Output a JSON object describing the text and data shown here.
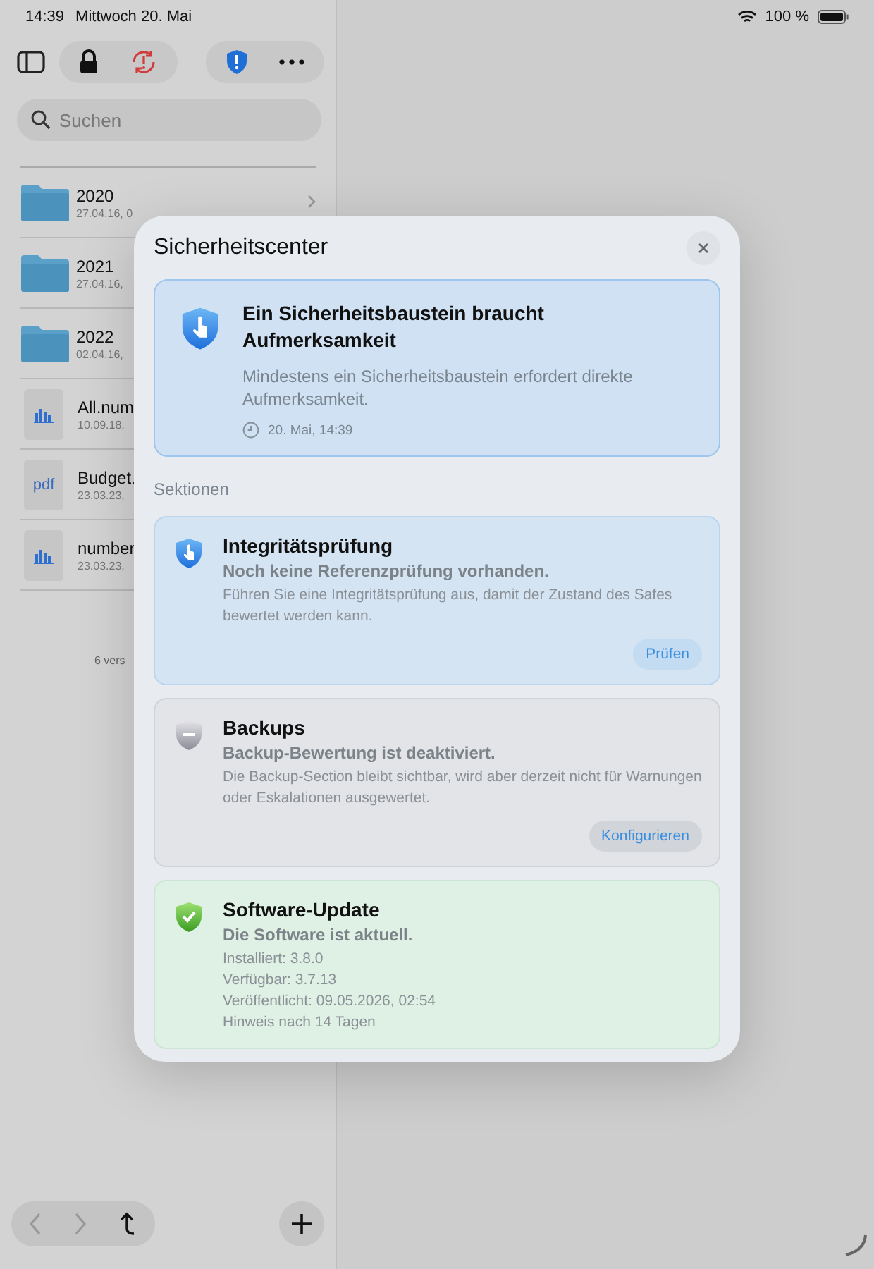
{
  "status_bar": {
    "time": "14:39",
    "date": "Mittwoch 20. Mai",
    "battery": "100 %"
  },
  "sidebar": {
    "search": {
      "placeholder": "Suchen"
    },
    "items": [
      {
        "kind": "folder",
        "name": "2020",
        "meta": "27.04.16, 0",
        "chevron": true
      },
      {
        "kind": "folder",
        "name": "2021",
        "meta": "27.04.16,"
      },
      {
        "kind": "folder",
        "name": "2022",
        "meta": "02.04.16,"
      },
      {
        "kind": "chart",
        "name": "All.num",
        "meta": "10.09.18,"
      },
      {
        "kind": "pdf",
        "badge": "pdf",
        "name": "Budget.",
        "meta": "23.03.23,"
      },
      {
        "kind": "chart",
        "name": "number",
        "meta": "23.03.23,"
      }
    ],
    "footer": "6 vers",
    "nav": {
      "back_disabled": true,
      "forward_disabled": true
    }
  },
  "dialog": {
    "title": "Sicherheitscenter",
    "alert": {
      "title": "Ein Sicherheitsbaustein braucht Aufmerksamkeit",
      "text": "Mindestens ein Sicherheitsbaustein erfordert direkte Aufmerksamkeit.",
      "time": "20. Mai, 14:39"
    },
    "sections_label": "Sektionen",
    "sections": [
      {
        "kind": "attention",
        "title": "Integritätsprüfung",
        "subtitle": "Noch keine Referenzprüfung vorhanden.",
        "lines": [
          "Führen Sie eine Integritätsprüfung aus, damit der Zustand des Safes bewertet werden kann."
        ],
        "button": "Prüfen"
      },
      {
        "kind": "disabled",
        "title": "Backups",
        "subtitle": "Backup-Bewertung ist deaktiviert.",
        "lines": [
          "Die Backup-Section bleibt sichtbar, wird aber derzeit nicht für Warnungen oder Eskalationen ausgewertet."
        ],
        "button": "Konfigurieren"
      },
      {
        "kind": "ok",
        "title": "Software-Update",
        "subtitle": "Die Software ist aktuell.",
        "lines": [
          "Installiert: 3.8.0",
          "Verfügbar: 3.7.13",
          "Veröffentlicht: 09.05.2026, 02:54",
          "Hinweis nach 14 Tagen"
        ]
      }
    ]
  }
}
